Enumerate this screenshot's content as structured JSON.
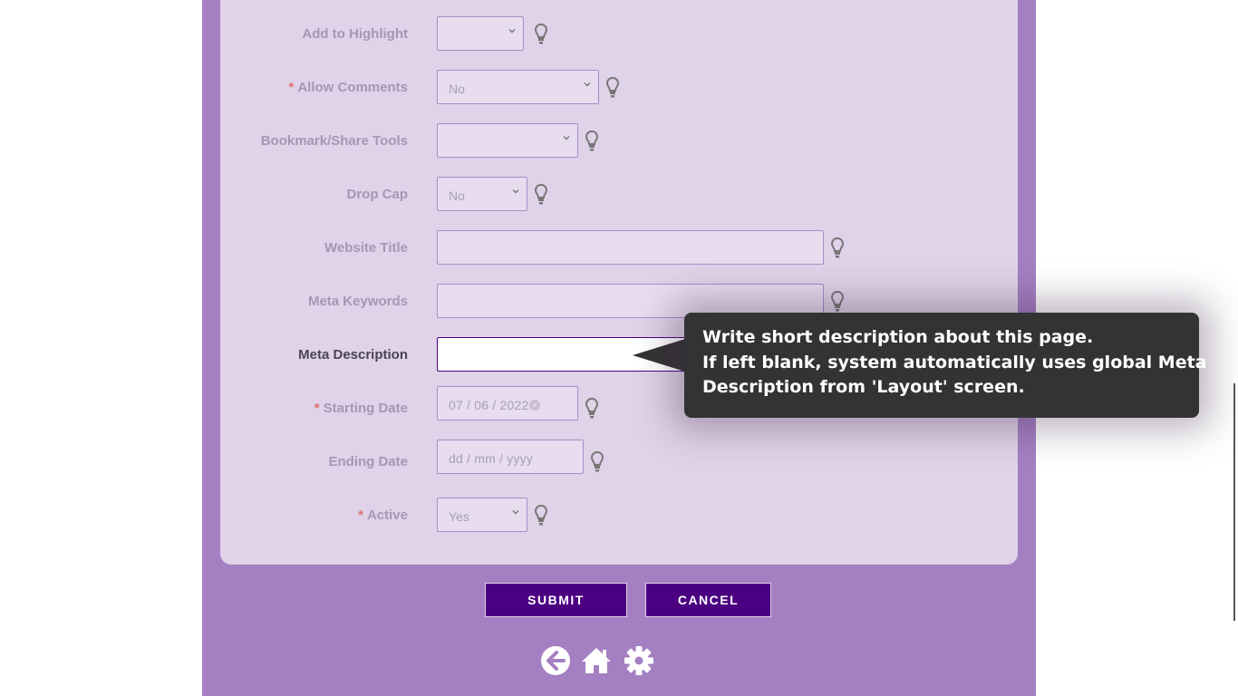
{
  "form": {
    "rows": [
      {
        "label": "Add to Highlight",
        "required": false,
        "type": "select",
        "value": ""
      },
      {
        "label": "Allow Comments",
        "required": true,
        "type": "select",
        "value": "No"
      },
      {
        "label": "Bookmark/Share Tools",
        "required": false,
        "type": "select",
        "value": ""
      },
      {
        "label": "Drop Cap",
        "required": false,
        "type": "select",
        "value": "No"
      },
      {
        "label": "Website Title",
        "required": false,
        "type": "text",
        "value": ""
      },
      {
        "label": "Meta Keywords",
        "required": false,
        "type": "text",
        "value": ""
      },
      {
        "label": "Meta Description",
        "required": false,
        "type": "text",
        "value": ""
      },
      {
        "label": "Starting Date",
        "required": true,
        "type": "date",
        "value": "07 / 06 / 2022"
      },
      {
        "label": "Ending Date",
        "required": false,
        "type": "date",
        "placeholder": "dd / mm / yyyy"
      },
      {
        "label": "Active",
        "required": true,
        "type": "select",
        "value": "Yes"
      }
    ],
    "required_mark": "*"
  },
  "tooltip": {
    "lines": [
      "Write short description about this page.",
      "If left blank, system automatically uses global Meta",
      "Description from 'Layout' screen."
    ]
  },
  "buttons": {
    "submit": "SUBMIT",
    "cancel": "CANCEL"
  },
  "footer_icons": [
    "back-arrow-icon",
    "home-icon",
    "gear-icon"
  ],
  "colors": {
    "page_bg": "#a47fc2",
    "panel_bg": "#e0d2e8",
    "button_bg": "#4b0082",
    "tooltip_bg": "#333333",
    "required": "#e2706f"
  }
}
